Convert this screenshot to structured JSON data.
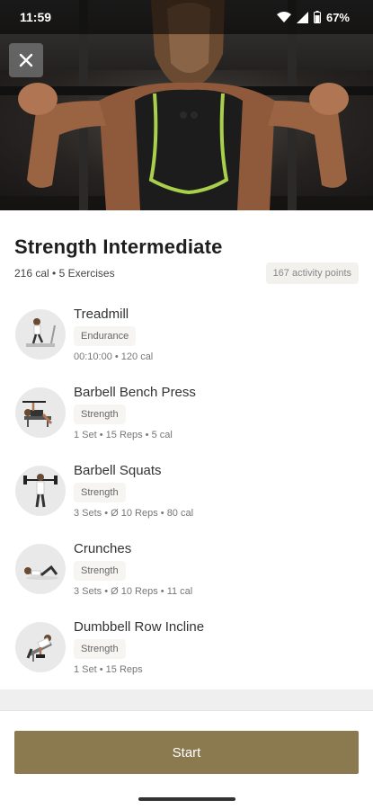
{
  "status_bar": {
    "time": "11:59",
    "battery": "67%",
    "icons": [
      "wifi-icon",
      "cell-signal-icon",
      "battery-icon"
    ]
  },
  "header": {
    "close_icon": "close-icon"
  },
  "workout": {
    "title": "Strength Intermediate",
    "meta": "216 cal • 5 Exercises",
    "activity_points": "167 activity points"
  },
  "exercises": [
    {
      "name": "Treadmill",
      "tag": "Endurance",
      "detail": "00:10:00 • 120 cal"
    },
    {
      "name": "Barbell Bench Press",
      "tag": "Strength",
      "detail": "1 Set • 15 Reps • 5 cal"
    },
    {
      "name": "Barbell Squats",
      "tag": "Strength",
      "detail": "3 Sets • Ø 10 Reps • 80 cal"
    },
    {
      "name": "Crunches",
      "tag": "Strength",
      "detail": "3 Sets • Ø 10 Reps • 11 cal"
    },
    {
      "name": "Dumbbell Row Incline",
      "tag": "Strength",
      "detail": "1 Set • 15 Reps"
    }
  ],
  "footer": {
    "start_label": "Start"
  },
  "colors": {
    "accent": "#8b7a4f",
    "hero_highlight": "#a8d04a"
  }
}
